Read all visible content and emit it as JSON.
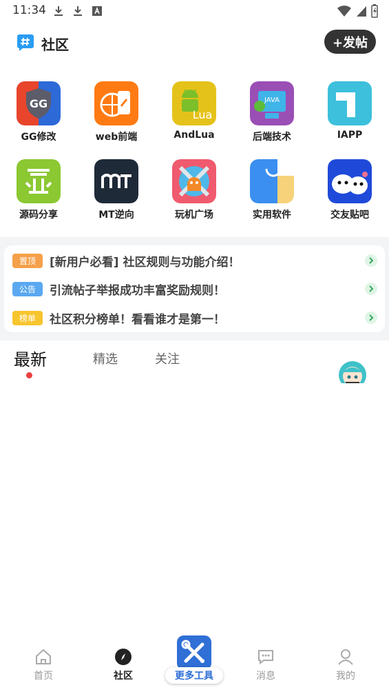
{
  "status_bar": {
    "time": "11:34",
    "icons": [
      "download-icon",
      "download-icon",
      "font-icon",
      "wifi-icon",
      "signal-icon",
      "battery-charging-icon"
    ]
  },
  "header": {
    "title": "社区",
    "post_button": "+发帖"
  },
  "categories": [
    {
      "label": "GG修改",
      "icon": "gg-guardian-icon"
    },
    {
      "label": "web前端",
      "icon": "web-frontend-icon"
    },
    {
      "label": "AndLua",
      "icon": "andlua-icon"
    },
    {
      "label": "后端技术",
      "icon": "backend-icon"
    },
    {
      "label": "IAPP",
      "icon": "iapp-icon"
    },
    {
      "label": "源码分享",
      "icon": "source-code-icon"
    },
    {
      "label": "MT逆向",
      "icon": "mt-reverse-icon"
    },
    {
      "label": "玩机广场",
      "icon": "android-tools-icon"
    },
    {
      "label": "实用软件",
      "icon": "app-store-icon"
    },
    {
      "label": "交友贴吧",
      "icon": "friends-icon"
    }
  ],
  "notices": [
    {
      "tag": "置顶",
      "text": "[新用户必看] 社区规则与功能介绍！",
      "color": "#f5a04a"
    },
    {
      "tag": "公告",
      "text": "引流帖子举报成功丰富奖励规则！",
      "color": "#5aa8f0"
    },
    {
      "tag": "榜单",
      "text": "社区积分榜单！看看谁才是第一！",
      "color": "#f7c52e"
    }
  ],
  "tabs": {
    "latest": "最新",
    "featured": "精选",
    "following": "关注"
  },
  "bottom_nav": {
    "home": "首页",
    "community": "社区",
    "tools": "更多工具",
    "messages": "消息",
    "profile": "我的"
  },
  "colors": {
    "accent_blue": "#2f6fd6",
    "dark_button": "#333333",
    "active_dot": "#e84040"
  }
}
